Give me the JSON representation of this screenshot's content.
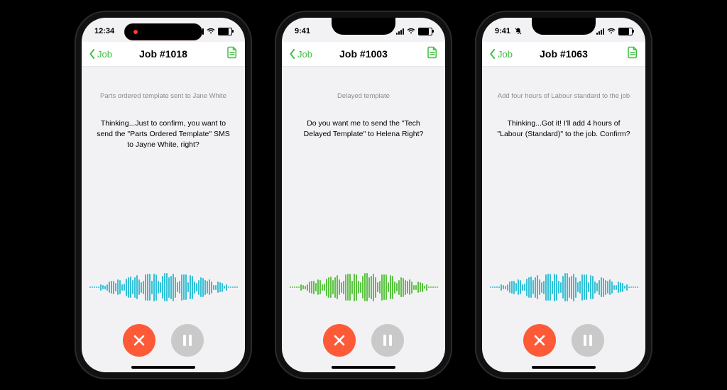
{
  "phones": [
    {
      "status_time": "12:34",
      "recording": true,
      "island": true,
      "dnd": false,
      "nav_back": "Job",
      "nav_title": "Job #1018",
      "note": "Parts ordered template sent to Jane White",
      "message": "Thinking...Just to confirm, you want to send the \"Parts Ordered Template\" SMS to Jayne White, right?",
      "wave_color": "#35c0d6"
    },
    {
      "status_time": "9:41",
      "recording": false,
      "island": false,
      "dnd": false,
      "nav_back": "Job",
      "nav_title": "Job #1003",
      "note": "Delayed template",
      "message": "Do you want me to send the \"Tech Delayed Template\" to Helena Right?",
      "wave_color": "#5cc244"
    },
    {
      "status_time": "9:41",
      "recording": false,
      "island": false,
      "dnd": true,
      "nav_back": "Job",
      "nav_title": "Job #1063",
      "note": "Add four hours of Labour standard to the job",
      "message": "Thinking...Got it! I'll add 4 hours of \"Labour (Standard)\" to the job. Confirm?",
      "wave_color": "#35c0d6"
    }
  ],
  "icons": {
    "back": "chevron-left-icon",
    "document": "document-icon",
    "cancel": "x-icon",
    "pause": "pause-icon",
    "dnd": "bell-slash-icon"
  },
  "colors": {
    "accent_green": "#3fbf3f",
    "cancel_red": "#ff5a37",
    "pause_grey": "#c9c9c9"
  }
}
